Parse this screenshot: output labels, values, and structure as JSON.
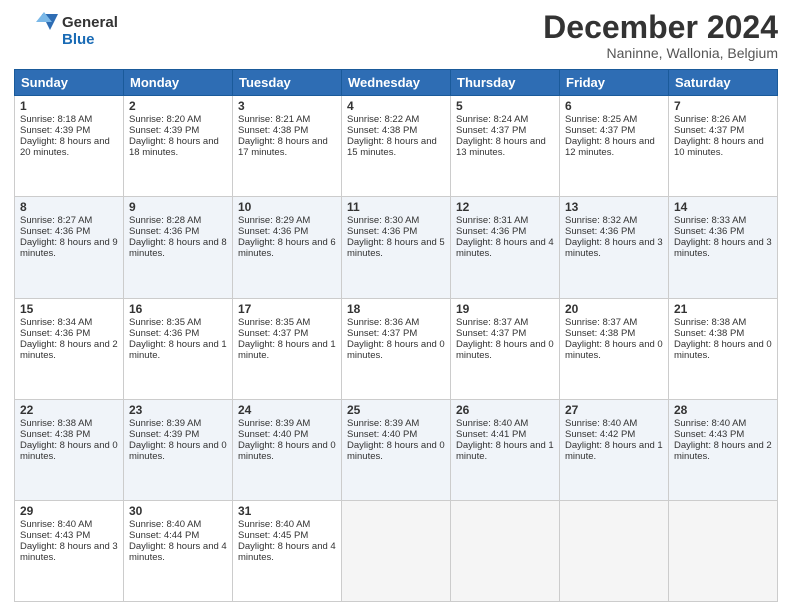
{
  "logo": {
    "general": "General",
    "blue": "Blue"
  },
  "header": {
    "month": "December 2024",
    "location": "Naninne, Wallonia, Belgium"
  },
  "days": [
    "Sunday",
    "Monday",
    "Tuesday",
    "Wednesday",
    "Thursday",
    "Friday",
    "Saturday"
  ],
  "weeks": [
    [
      {
        "day": "1",
        "sunrise": "Sunrise: 8:18 AM",
        "sunset": "Sunset: 4:39 PM",
        "daylight": "Daylight: 8 hours and 20 minutes."
      },
      {
        "day": "2",
        "sunrise": "Sunrise: 8:20 AM",
        "sunset": "Sunset: 4:39 PM",
        "daylight": "Daylight: 8 hours and 18 minutes."
      },
      {
        "day": "3",
        "sunrise": "Sunrise: 8:21 AM",
        "sunset": "Sunset: 4:38 PM",
        "daylight": "Daylight: 8 hours and 17 minutes."
      },
      {
        "day": "4",
        "sunrise": "Sunrise: 8:22 AM",
        "sunset": "Sunset: 4:38 PM",
        "daylight": "Daylight: 8 hours and 15 minutes."
      },
      {
        "day": "5",
        "sunrise": "Sunrise: 8:24 AM",
        "sunset": "Sunset: 4:37 PM",
        "daylight": "Daylight: 8 hours and 13 minutes."
      },
      {
        "day": "6",
        "sunrise": "Sunrise: 8:25 AM",
        "sunset": "Sunset: 4:37 PM",
        "daylight": "Daylight: 8 hours and 12 minutes."
      },
      {
        "day": "7",
        "sunrise": "Sunrise: 8:26 AM",
        "sunset": "Sunset: 4:37 PM",
        "daylight": "Daylight: 8 hours and 10 minutes."
      }
    ],
    [
      {
        "day": "8",
        "sunrise": "Sunrise: 8:27 AM",
        "sunset": "Sunset: 4:36 PM",
        "daylight": "Daylight: 8 hours and 9 minutes."
      },
      {
        "day": "9",
        "sunrise": "Sunrise: 8:28 AM",
        "sunset": "Sunset: 4:36 PM",
        "daylight": "Daylight: 8 hours and 8 minutes."
      },
      {
        "day": "10",
        "sunrise": "Sunrise: 8:29 AM",
        "sunset": "Sunset: 4:36 PM",
        "daylight": "Daylight: 8 hours and 6 minutes."
      },
      {
        "day": "11",
        "sunrise": "Sunrise: 8:30 AM",
        "sunset": "Sunset: 4:36 PM",
        "daylight": "Daylight: 8 hours and 5 minutes."
      },
      {
        "day": "12",
        "sunrise": "Sunrise: 8:31 AM",
        "sunset": "Sunset: 4:36 PM",
        "daylight": "Daylight: 8 hours and 4 minutes."
      },
      {
        "day": "13",
        "sunrise": "Sunrise: 8:32 AM",
        "sunset": "Sunset: 4:36 PM",
        "daylight": "Daylight: 8 hours and 3 minutes."
      },
      {
        "day": "14",
        "sunrise": "Sunrise: 8:33 AM",
        "sunset": "Sunset: 4:36 PM",
        "daylight": "Daylight: 8 hours and 3 minutes."
      }
    ],
    [
      {
        "day": "15",
        "sunrise": "Sunrise: 8:34 AM",
        "sunset": "Sunset: 4:36 PM",
        "daylight": "Daylight: 8 hours and 2 minutes."
      },
      {
        "day": "16",
        "sunrise": "Sunrise: 8:35 AM",
        "sunset": "Sunset: 4:36 PM",
        "daylight": "Daylight: 8 hours and 1 minute."
      },
      {
        "day": "17",
        "sunrise": "Sunrise: 8:35 AM",
        "sunset": "Sunset: 4:37 PM",
        "daylight": "Daylight: 8 hours and 1 minute."
      },
      {
        "day": "18",
        "sunrise": "Sunrise: 8:36 AM",
        "sunset": "Sunset: 4:37 PM",
        "daylight": "Daylight: 8 hours and 0 minutes."
      },
      {
        "day": "19",
        "sunrise": "Sunrise: 8:37 AM",
        "sunset": "Sunset: 4:37 PM",
        "daylight": "Daylight: 8 hours and 0 minutes."
      },
      {
        "day": "20",
        "sunrise": "Sunrise: 8:37 AM",
        "sunset": "Sunset: 4:38 PM",
        "daylight": "Daylight: 8 hours and 0 minutes."
      },
      {
        "day": "21",
        "sunrise": "Sunrise: 8:38 AM",
        "sunset": "Sunset: 4:38 PM",
        "daylight": "Daylight: 8 hours and 0 minutes."
      }
    ],
    [
      {
        "day": "22",
        "sunrise": "Sunrise: 8:38 AM",
        "sunset": "Sunset: 4:38 PM",
        "daylight": "Daylight: 8 hours and 0 minutes."
      },
      {
        "day": "23",
        "sunrise": "Sunrise: 8:39 AM",
        "sunset": "Sunset: 4:39 PM",
        "daylight": "Daylight: 8 hours and 0 minutes."
      },
      {
        "day": "24",
        "sunrise": "Sunrise: 8:39 AM",
        "sunset": "Sunset: 4:40 PM",
        "daylight": "Daylight: 8 hours and 0 minutes."
      },
      {
        "day": "25",
        "sunrise": "Sunrise: 8:39 AM",
        "sunset": "Sunset: 4:40 PM",
        "daylight": "Daylight: 8 hours and 0 minutes."
      },
      {
        "day": "26",
        "sunrise": "Sunrise: 8:40 AM",
        "sunset": "Sunset: 4:41 PM",
        "daylight": "Daylight: 8 hours and 1 minute."
      },
      {
        "day": "27",
        "sunrise": "Sunrise: 8:40 AM",
        "sunset": "Sunset: 4:42 PM",
        "daylight": "Daylight: 8 hours and 1 minute."
      },
      {
        "day": "28",
        "sunrise": "Sunrise: 8:40 AM",
        "sunset": "Sunset: 4:43 PM",
        "daylight": "Daylight: 8 hours and 2 minutes."
      }
    ],
    [
      {
        "day": "29",
        "sunrise": "Sunrise: 8:40 AM",
        "sunset": "Sunset: 4:43 PM",
        "daylight": "Daylight: 8 hours and 3 minutes."
      },
      {
        "day": "30",
        "sunrise": "Sunrise: 8:40 AM",
        "sunset": "Sunset: 4:44 PM",
        "daylight": "Daylight: 8 hours and 4 minutes."
      },
      {
        "day": "31",
        "sunrise": "Sunrise: 8:40 AM",
        "sunset": "Sunset: 4:45 PM",
        "daylight": "Daylight: 8 hours and 4 minutes."
      },
      null,
      null,
      null,
      null
    ]
  ]
}
